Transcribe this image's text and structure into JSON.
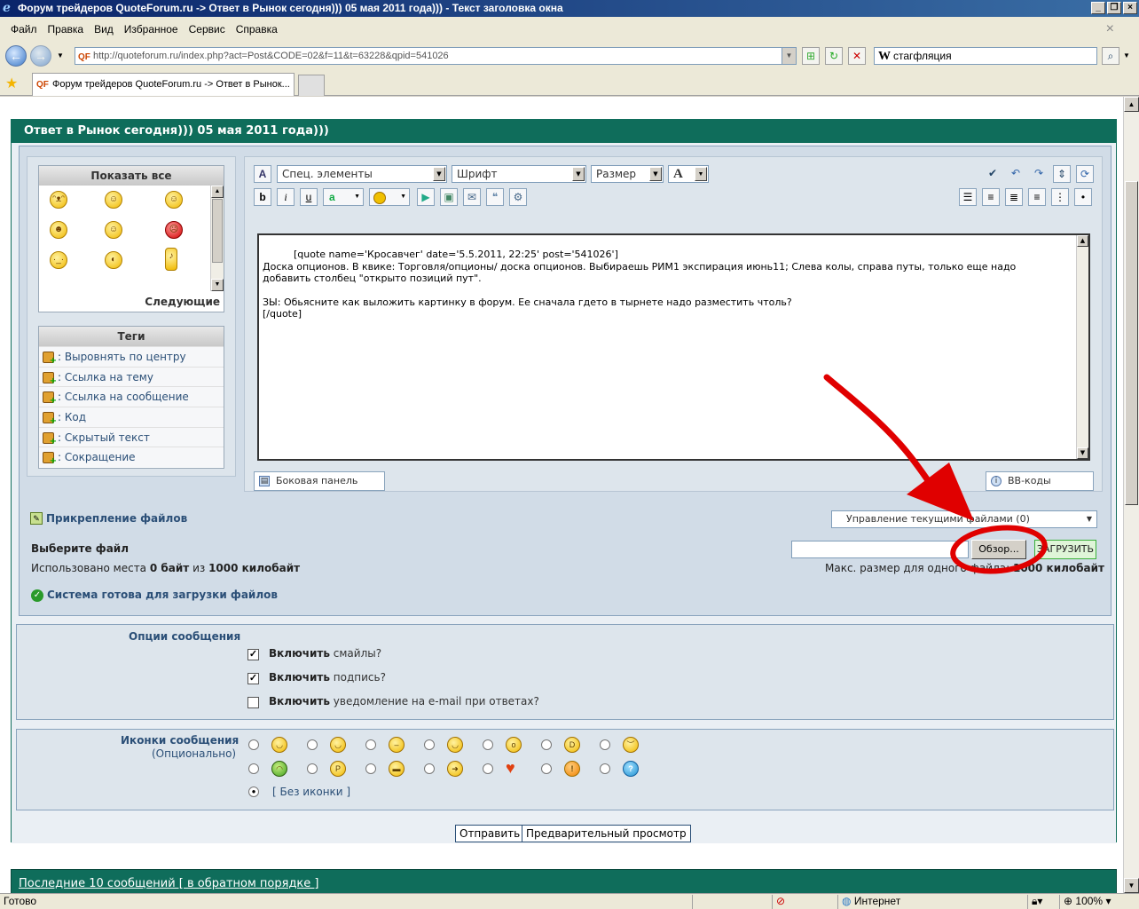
{
  "window": {
    "title": "Форум трейдеров QuoteForum.ru -> Ответ в Рынок сегодня))) 05 мая 2011 года))) - Текст заголовка окна"
  },
  "menu": [
    "Файл",
    "Правка",
    "Вид",
    "Избранное",
    "Сервис",
    "Справка"
  ],
  "address": {
    "url": "http://quoteforum.ru/index.php?act=Post&CODE=02&f=11&t=63228&qpid=541026",
    "search_value": "стагфляция",
    "search_engine_glyph": "W"
  },
  "tabs": [
    {
      "label": "Форум трейдеров QuoteForum.ru -> Ответ в Рынок..."
    }
  ],
  "page": {
    "heading": "Ответ в Рынок сегодня))) 05 мая 2011 года)))",
    "smileys_box": {
      "title": "Показать все",
      "next": "Следующие"
    },
    "tags_box": {
      "title": "Теги",
      "items": [
        ": Выровнять по центру",
        ": Ссылка на тему",
        ": Ссылка на сообщение",
        ": Код",
        ": Скрытый текст",
        ": Сокращение"
      ]
    },
    "editor": {
      "special": "Спец. элементы",
      "font": "Шрифт",
      "size": "Размер",
      "color_glyph": "A",
      "message": "[quote name='Кросавчег' date='5.5.2011, 22:25' post='541026']\nДоска опционов. В квике: Торговля/опционы/ доска опционов. Выбираешь РИМ1 экспирация июнь11; Слева колы, справа путы, только еще надо\nдобавить столбец \"открыто позиций пут\".\n\nЗЫ: Обьясните как выложить картинку в форум. Ее сначала гдето в тырнете надо разместить чтоль?\n[/quote]",
      "side_panel": "Боковая панель",
      "bb_codes": "BB-коды"
    },
    "attachments": {
      "title": "Прикрепление файлов",
      "manage": "Управление текущими файлами (0)",
      "choose_file": "Выберите файл",
      "used_prefix": "Использовано места",
      "used_value": "0 байт",
      "used_of": "из",
      "used_total": "1000 килобайт",
      "browse": "Обзор...",
      "upload": "ЗАГРУЗИТЬ",
      "max_size_label": "Макс. размер для одного файла:",
      "max_size_value": "1000 килобайт",
      "ready": "Система готова для загрузки файлов"
    },
    "options": {
      "title": "Опции сообщения",
      "items": [
        {
          "bold": "Включить",
          "rest": "смайлы?",
          "checked": true
        },
        {
          "bold": "Включить",
          "rest": "подпись?",
          "checked": true
        },
        {
          "bold": "Включить",
          "rest": "уведомление на e-mail при ответах?",
          "checked": false
        }
      ]
    },
    "icons": {
      "title": "Иконки сообщения",
      "subtitle": "(Опционально)",
      "none_label": "[ Без иконки ]"
    },
    "submit": "Отправить",
    "preview": "Предварительный просмотр",
    "last_posts": "Последние 10 сообщений [ в обратном порядке ]"
  },
  "status": {
    "text": "Готово",
    "zone": "Интернет",
    "zoom": "100%"
  },
  "colors": {
    "header_green": "#0f6d5b",
    "annotation_red": "#e00000"
  }
}
